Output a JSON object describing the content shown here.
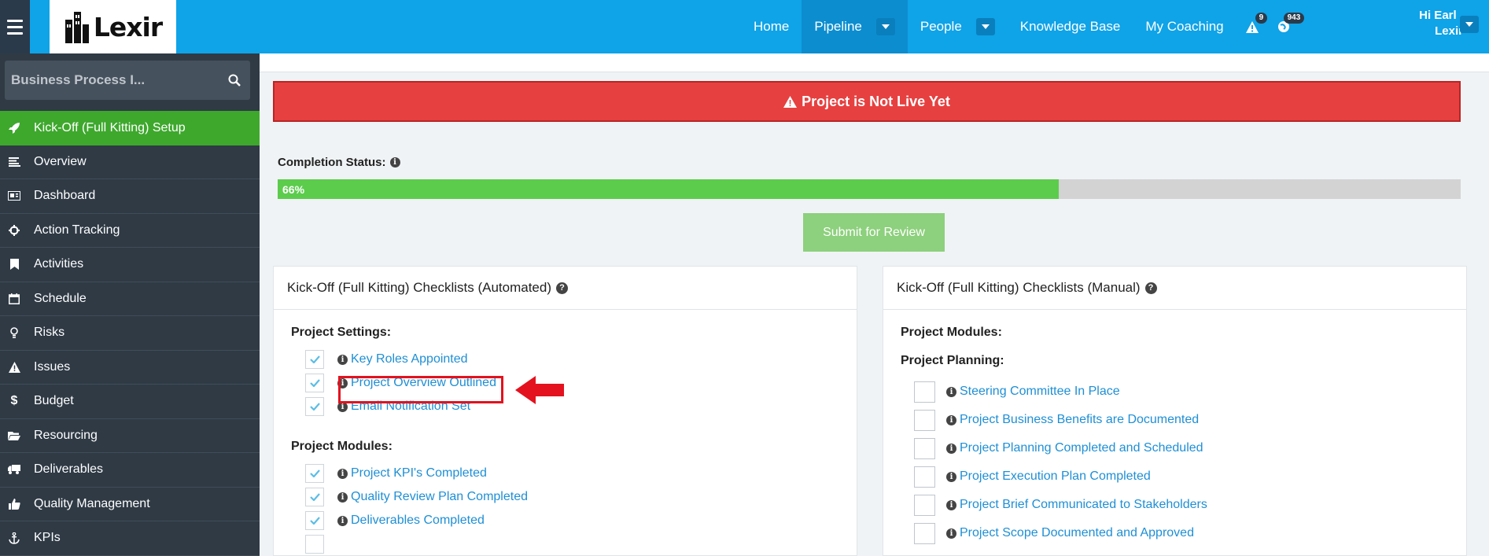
{
  "brand": {
    "name": "Lexir"
  },
  "nav": {
    "items": [
      {
        "label": "Home"
      },
      {
        "label": "Pipeline"
      },
      {
        "label": "People"
      },
      {
        "label": "Knowledge Base"
      },
      {
        "label": "My Coaching"
      }
    ],
    "alerts_count": "9",
    "notifications_count": "943",
    "user_greeting": "Hi Earl ,",
    "user_org": "Lexir"
  },
  "sidebar": {
    "search_placeholder": "Business Process I...",
    "items": [
      {
        "label": "Kick-Off (Full Kitting) Setup",
        "icon": "rocket-icon"
      },
      {
        "label": "Overview",
        "icon": "list-icon"
      },
      {
        "label": "Dashboard",
        "icon": "dashboard-icon"
      },
      {
        "label": "Action Tracking",
        "icon": "crosshair-icon"
      },
      {
        "label": "Activities",
        "icon": "bookmark-icon"
      },
      {
        "label": "Schedule",
        "icon": "calendar-icon"
      },
      {
        "label": "Risks",
        "icon": "lightbulb-icon"
      },
      {
        "label": "Issues",
        "icon": "warning-icon"
      },
      {
        "label": "Budget",
        "icon": "dollar-icon"
      },
      {
        "label": "Resourcing",
        "icon": "folder-icon"
      },
      {
        "label": "Deliverables",
        "icon": "truck-icon"
      },
      {
        "label": "Quality Management",
        "icon": "thumbs-up-icon"
      },
      {
        "label": "KPIs",
        "icon": "anchor-icon"
      }
    ]
  },
  "alert": {
    "text": "Project is Not Live Yet",
    "color": "#e74040"
  },
  "completion": {
    "label": "Completion Status:",
    "value": 66,
    "text": "66%"
  },
  "submit_label": "Submit for Review",
  "panel_automated": {
    "title": "Kick-Off (Full Kitting) Checklists (Automated)",
    "section_settings": "Project Settings:",
    "settings_items": [
      {
        "label": "Key Roles Appointed",
        "checked": true
      },
      {
        "label": "Project Overview Outlined",
        "checked": true
      },
      {
        "label": "Email Notification Set",
        "checked": true
      }
    ],
    "section_modules": "Project Modules:",
    "module_items": [
      {
        "label": "Project KPI's Completed",
        "checked": true
      },
      {
        "label": "Quality Review Plan Completed",
        "checked": true
      },
      {
        "label": "Deliverables Completed",
        "checked": true
      }
    ]
  },
  "panel_manual": {
    "title": "Kick-Off (Full Kitting) Checklists (Manual)",
    "section_modules": "Project Modules:",
    "section_planning": "Project Planning:",
    "planning_items": [
      {
        "label": "Steering Committee In Place",
        "checked": false
      },
      {
        "label": "Project Business Benefits are Documented",
        "checked": false
      },
      {
        "label": "Project Planning Completed and Scheduled",
        "checked": false
      },
      {
        "label": "Project Execution Plan Completed",
        "checked": false
      },
      {
        "label": "Project Brief Communicated to Stakeholders",
        "checked": false
      },
      {
        "label": "Project Scope Documented and Approved",
        "checked": false
      }
    ]
  }
}
